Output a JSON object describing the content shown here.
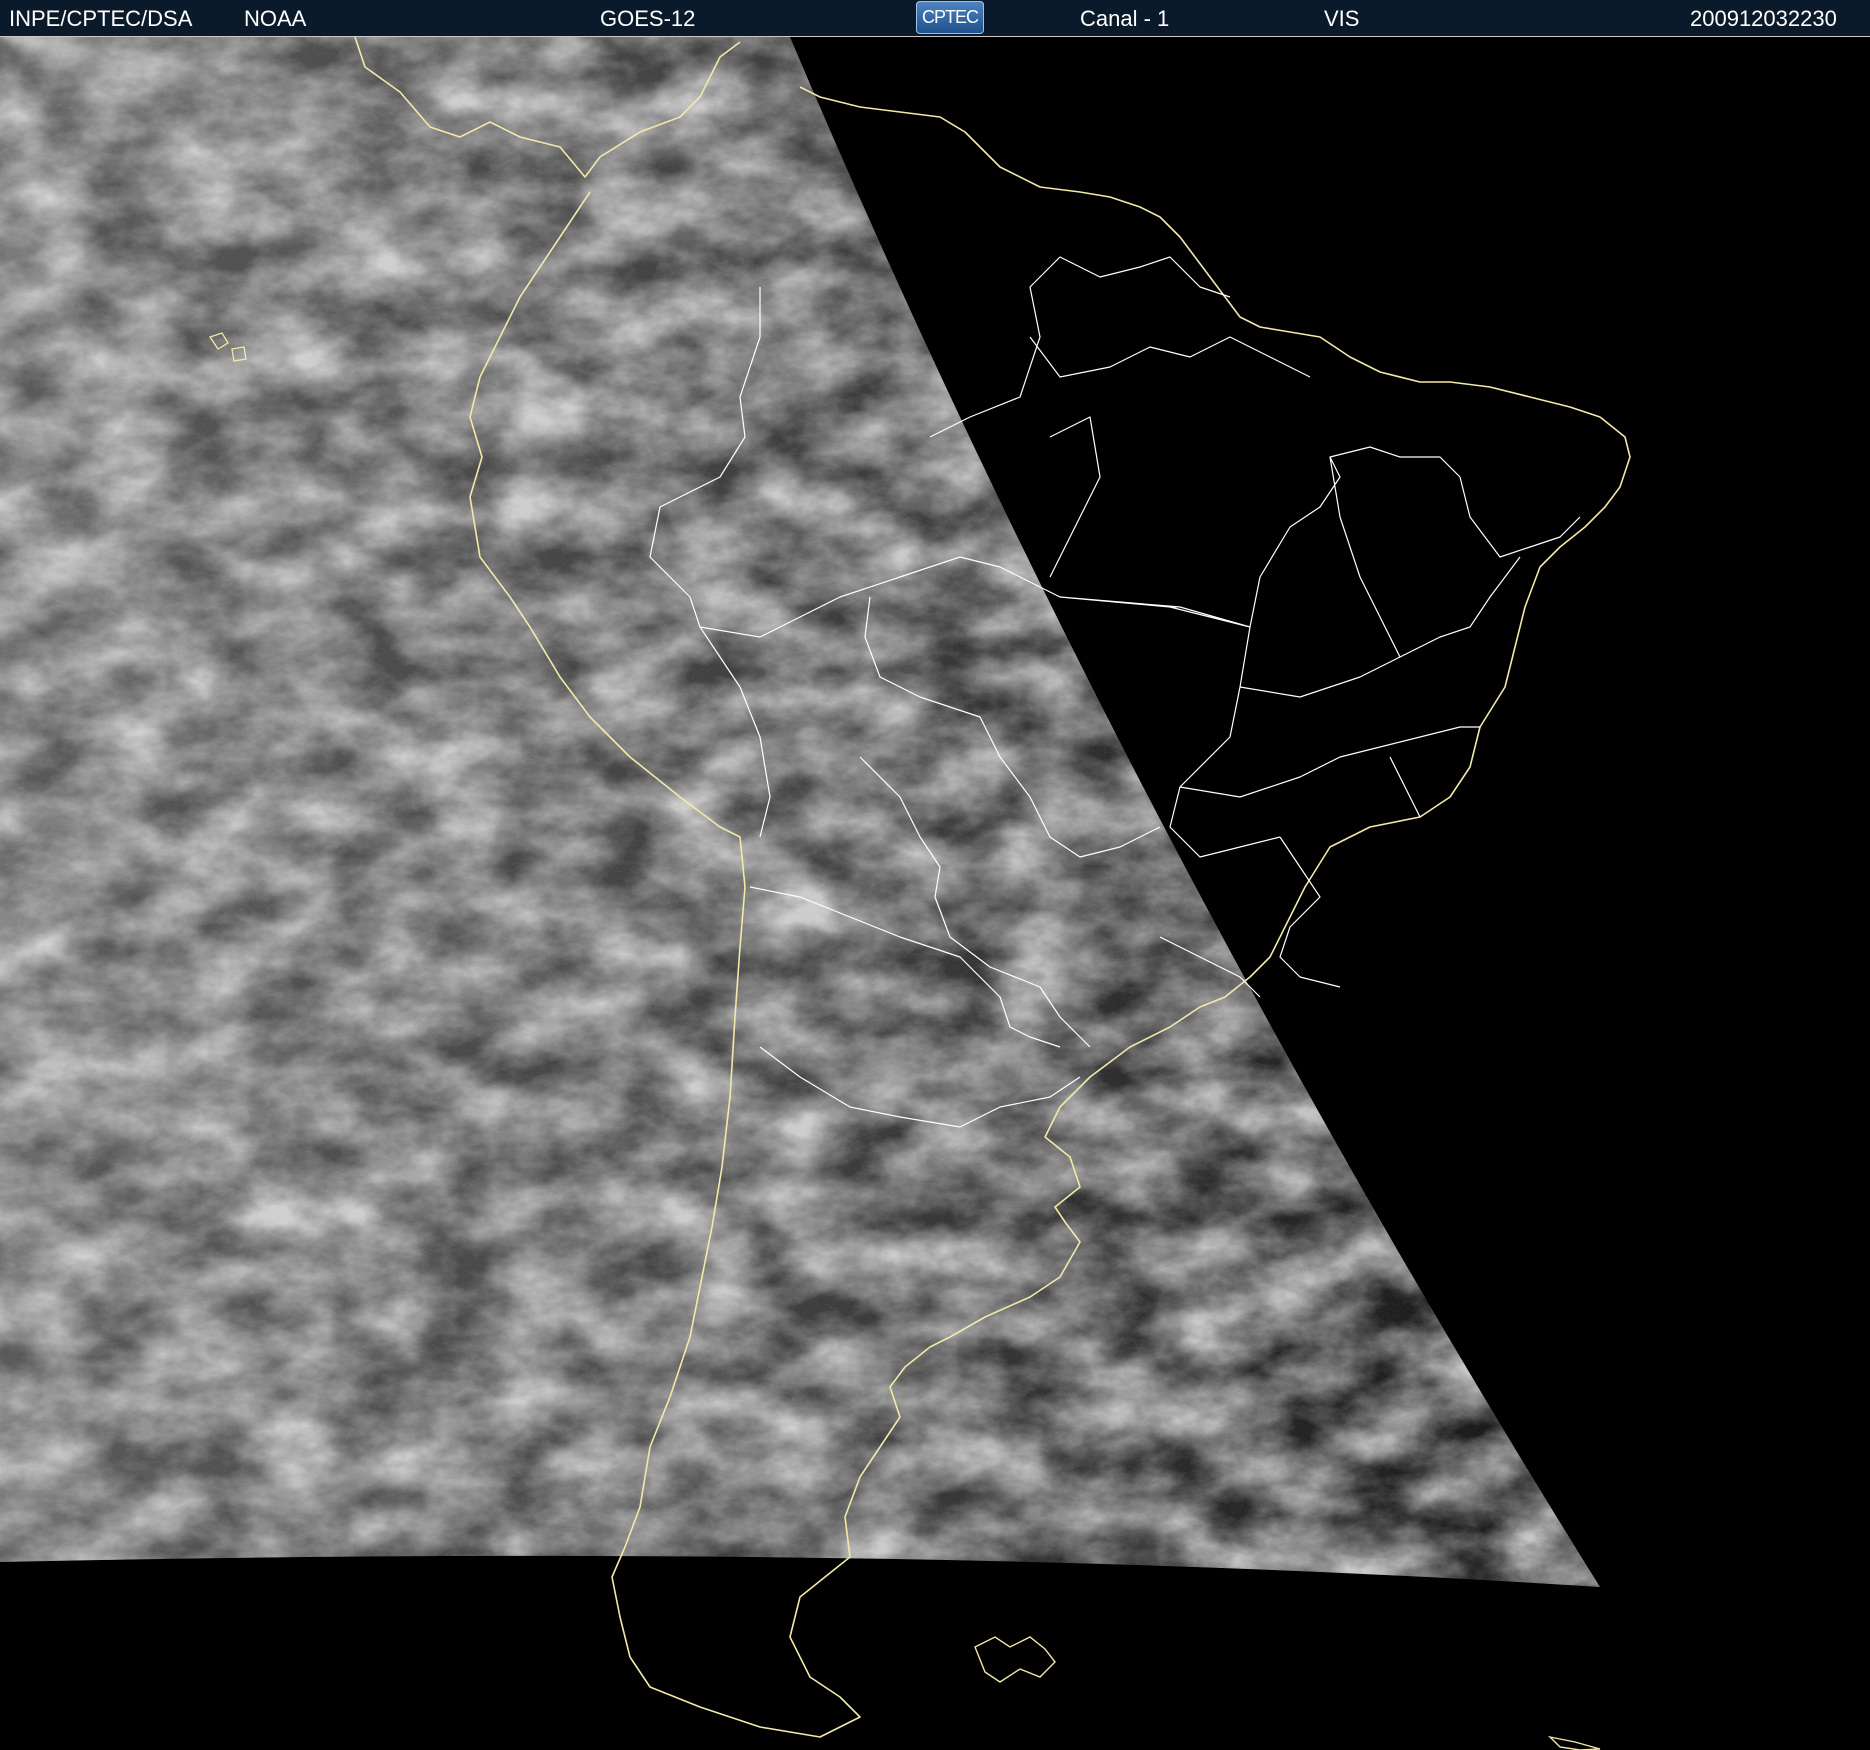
{
  "header": {
    "source": "INPE/CPTEC/DSA",
    "agency": "NOAA",
    "satellite": "GOES-12",
    "logo_text": "CPTEC",
    "channel": "Canal - 1",
    "band": "VIS",
    "timestamp": "200912032230"
  },
  "colors": {
    "header_bg": "#0b1a2a",
    "coastline": "#f2e9a8",
    "borders": "#ffffff",
    "space": "#000000"
  },
  "map": {
    "projection": "satellite-visible-image",
    "region": "South America"
  }
}
